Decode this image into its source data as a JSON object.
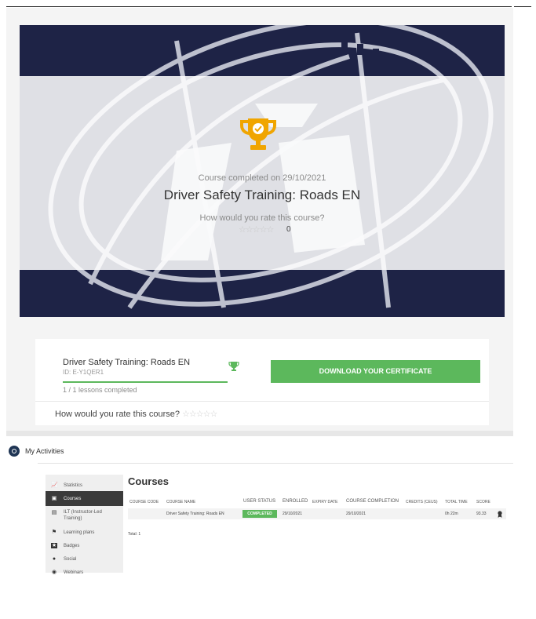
{
  "hero": {
    "completed_on": "Course completed on 29/10/2021",
    "course_title": "Driver Safety Training: Roads EN",
    "rate_question": "How would you rate this course?",
    "rating_stars": "☆☆☆☆☆",
    "rating_count": "0"
  },
  "course_card": {
    "title": "Driver Safety Training: Roads EN",
    "id_label": "ID: E-Y1QER1",
    "lessons_text": "1 / 1 lessons completed",
    "progress": 1.0,
    "certificate_button": "DOWNLOAD YOUR CERTIFICATE",
    "rate_question": "How would you rate this course?",
    "rating_stars": "☆☆☆☆☆"
  },
  "activities": {
    "title": "My Activities",
    "sidebar": [
      {
        "label": "Statistics",
        "icon": "chart-icon",
        "active": false
      },
      {
        "label": "Courses",
        "icon": "courses-icon",
        "active": true
      },
      {
        "label": "ILT (Instructor-Led Training)",
        "icon": "ilt-icon",
        "active": false
      },
      {
        "label": "Learning plans",
        "icon": "learning-plan-icon",
        "active": false
      },
      {
        "label": "Badges",
        "icon": "badge-icon",
        "active": false
      },
      {
        "label": "Social",
        "icon": "social-icon",
        "active": false
      },
      {
        "label": "Webinars",
        "icon": "webinar-icon",
        "active": false
      }
    ],
    "heading": "Courses",
    "columns": [
      "COURSE CODE",
      "COURSE NAME",
      "USER STATUS",
      "ENROLLED",
      "EXPIRY DATE",
      "COURSE COMPLETION",
      "CREDITS (CEUS)",
      "TOTAL TIME",
      "SCORE"
    ],
    "rows": [
      {
        "course_code": "",
        "course_name": "Driver Safety Training: Roads EN",
        "user_status": "COMPLETED",
        "enrolled": "29/10/2021",
        "expiry_date": "",
        "course_completion": "29/10/2021",
        "credits": "",
        "total_time": "0h 22m",
        "score": "93.33"
      }
    ],
    "total": "Total: 1"
  },
  "colors": {
    "accent_green": "#5cb85c",
    "trophy_orange": "#f0a500",
    "hero_navy": "#1e2346"
  }
}
